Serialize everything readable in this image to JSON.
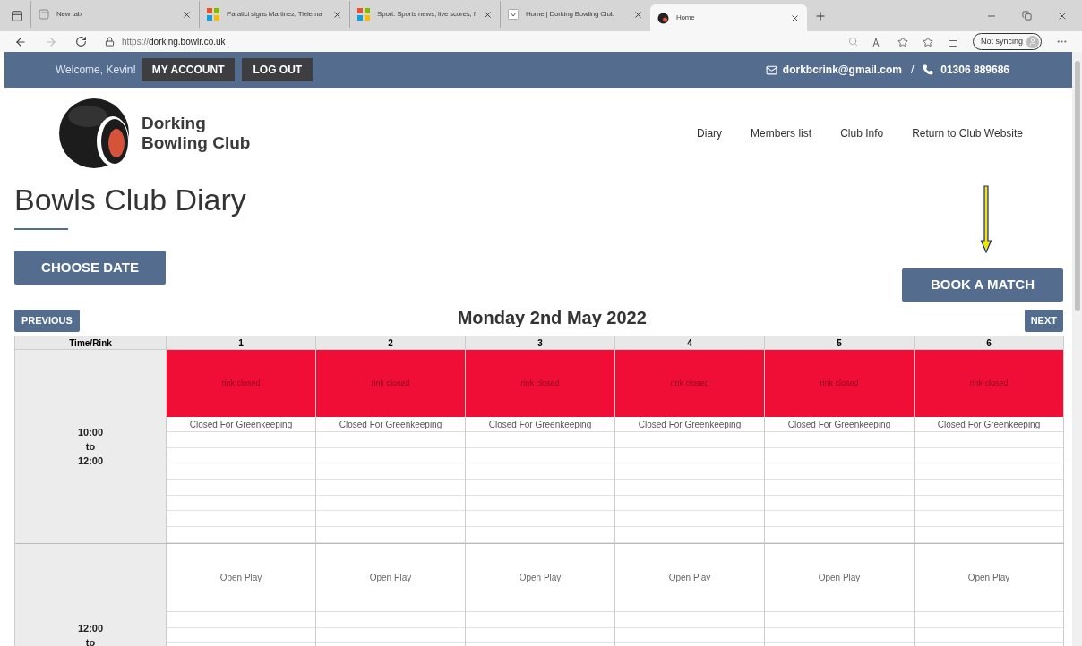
{
  "browser": {
    "tabs": [
      {
        "kind": "page",
        "title": "New tab",
        "selected": false
      },
      {
        "kind": "grid",
        "title": "Paratici signs Martinez, Tielema",
        "selected": false
      },
      {
        "kind": "grid",
        "title": "Sport: Sports news, live scores, f",
        "selected": false
      },
      {
        "kind": "site",
        "title": "Home | Dorking Bowling Club",
        "selected": false
      },
      {
        "kind": "ball",
        "title": "Home",
        "selected": true
      }
    ],
    "url_prefix": "https://",
    "url_host": "dorking.bowlr.co.uk",
    "sync": "Not syncing"
  },
  "topbar": {
    "welcome": "Welcome, Kevin!",
    "buttons": [
      "MY ACCOUNT",
      "LOG OUT"
    ],
    "email": "dorkbcrink@gmail.com",
    "separator": "/",
    "phone": "01306 889686"
  },
  "brand": {
    "line1": "Dorking",
    "line2": "Bowling Club"
  },
  "nav": [
    "Diary",
    "Members list",
    "Club Info",
    "Return to Club Website"
  ],
  "title": "Bowls Club Diary",
  "choose_date": "CHOOSE DATE",
  "book_match": "BOOK A MATCH",
  "previous": "PREVIOUS",
  "date": "Monday 2nd May 2022",
  "next": "NEXT",
  "table": {
    "corner": "Time/Rink",
    "columns": [
      "1",
      "2",
      "3",
      "4",
      "5",
      "6"
    ],
    "slots": [
      {
        "time": [
          "10:00",
          "to",
          "12:00"
        ],
        "cells": [
          {
            "kind": "closed",
            "text": "rink closed",
            "note": "Closed For Greenkeeping"
          },
          {
            "kind": "closed",
            "text": "rink closed",
            "note": "Closed For Greenkeeping"
          },
          {
            "kind": "closed",
            "text": "rink closed",
            "note": "Closed For Greenkeeping"
          },
          {
            "kind": "closed",
            "text": "rink closed",
            "note": "Closed For Greenkeeping"
          },
          {
            "kind": "closed",
            "text": "rink closed",
            "note": "Closed For Greenkeeping"
          },
          {
            "kind": "closed",
            "text": "rink closed",
            "note": "Closed For Greenkeeping"
          }
        ]
      },
      {
        "time": [
          "12:00",
          "to"
        ],
        "cells": [
          {
            "kind": "open",
            "text": "Open Play"
          },
          {
            "kind": "open",
            "text": "Open Play"
          },
          {
            "kind": "open",
            "text": "Open Play"
          },
          {
            "kind": "open",
            "text": "Open Play"
          },
          {
            "kind": "open",
            "text": "Open Play"
          },
          {
            "kind": "open",
            "text": "Open Play"
          }
        ]
      }
    ]
  }
}
